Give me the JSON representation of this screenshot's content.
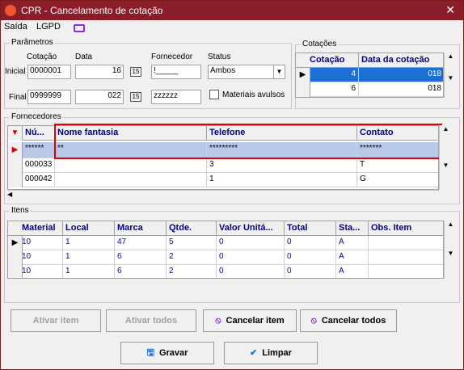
{
  "title": "CPR - Cancelamento de cotação",
  "menu": {
    "saida": "Saída",
    "lgpd": "LGPD"
  },
  "parametros": {
    "label": "Parâmetros",
    "headers": {
      "cotacao": "Cotação",
      "data": "Data",
      "fornecedor": "Fornecedor",
      "status": "Status"
    },
    "inicial": {
      "label": "Inicial",
      "cotacao": "0000001",
      "data": "16",
      "fornecedor": "!_____"
    },
    "final": {
      "label": "Final",
      "cotacao": "0999999",
      "data": "022",
      "fornecedor": "zzzzzz"
    },
    "status": "Ambos",
    "materiais": "Materiais avulsos"
  },
  "cotacoes": {
    "label": "Cotações",
    "headers": [
      "Cotação",
      "Data da cotação"
    ],
    "rows": [
      {
        "cotacao": "4",
        "data": "018"
      },
      {
        "cotacao": "6",
        "data": "018"
      }
    ]
  },
  "fornecedores": {
    "label": "Fornecedores",
    "headers": [
      "Nú...",
      "Nome fantasia",
      "Telefone",
      "Contato"
    ],
    "rows": [
      {
        "num": "******",
        "nome": "**",
        "telefone": "*********",
        "contato": "*******"
      },
      {
        "num": "000033",
        "nome": "",
        "telefone": "3",
        "contato": "T"
      },
      {
        "num": "000042",
        "nome": "",
        "telefone": "1",
        "contato": "G"
      }
    ]
  },
  "itens": {
    "label": "Itens",
    "headers": [
      "Material",
      "Local",
      "Marca",
      "Qtde.",
      "Valor Unitá...",
      "Total",
      "Sta...",
      "Obs. Item"
    ],
    "rows": [
      {
        "material": "10",
        "local": "1",
        "marca": "47",
        "qtde": "5",
        "valor": "0",
        "total": "0",
        "status": "A",
        "obs": ""
      },
      {
        "material": "10",
        "local": "1",
        "marca": "6",
        "qtde": "2",
        "valor": "0",
        "total": "0",
        "status": "A",
        "obs": ""
      },
      {
        "material": "10",
        "local": "1",
        "marca": "6",
        "qtde": "2",
        "valor": "0",
        "total": "0",
        "status": "A",
        "obs": ""
      }
    ]
  },
  "buttons": {
    "ativar_item": "Ativar item",
    "ativar_todos": "Ativar todos",
    "cancelar_item": "Cancelar item",
    "cancelar_todos": "Cancelar todos",
    "gravar": "Gravar",
    "limpar": "Limpar"
  }
}
